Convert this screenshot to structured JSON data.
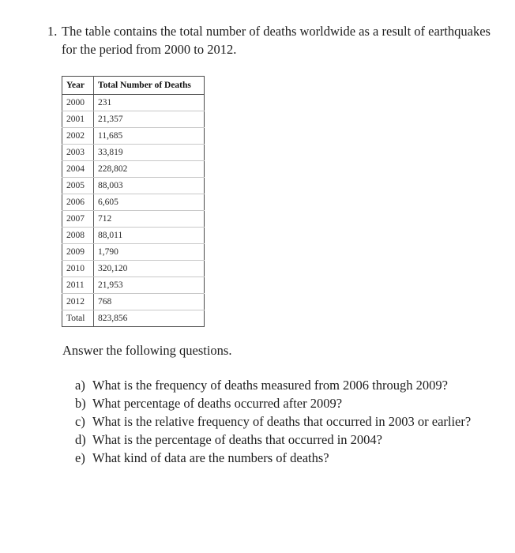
{
  "problem": {
    "number": "1.",
    "text": "The table contains the total number of deaths worldwide as a result of earthquakes for the period from 2000 to 2012."
  },
  "table": {
    "headers": [
      "Year",
      "Total Number of Deaths"
    ],
    "rows": [
      {
        "year": "2000",
        "deaths": "231"
      },
      {
        "year": "2001",
        "deaths": "21,357"
      },
      {
        "year": "2002",
        "deaths": "11,685"
      },
      {
        "year": "2003",
        "deaths": "33,819"
      },
      {
        "year": "2004",
        "deaths": "228,802"
      },
      {
        "year": "2005",
        "deaths": "88,003"
      },
      {
        "year": "2006",
        "deaths": "6,605"
      },
      {
        "year": "2007",
        "deaths": "712"
      },
      {
        "year": "2008",
        "deaths": "88,011"
      },
      {
        "year": "2009",
        "deaths": "1,790"
      },
      {
        "year": "2010",
        "deaths": "320,120"
      },
      {
        "year": "2011",
        "deaths": "21,953"
      },
      {
        "year": "2012",
        "deaths": "768"
      },
      {
        "year": "Total",
        "deaths": "823,856"
      }
    ]
  },
  "answer_prompt": "Answer the following questions.",
  "questions": [
    {
      "label": "a)",
      "text": "What is the frequency of deaths measured from 2006 through 2009?"
    },
    {
      "label": "b)",
      "text": "What percentage of deaths occurred after 2009?"
    },
    {
      "label": "c)",
      "text": "What is the relative frequency of deaths that occurred in 2003 or earlier?"
    },
    {
      "label": "d)",
      "text": "What is the percentage of deaths that occurred in 2004?"
    },
    {
      "label": "e)",
      "text": "What kind of data are the numbers of deaths?"
    }
  ],
  "colors": {
    "text": "#1d1d1d",
    "table_border": "#4a4a4a",
    "table_row_rule": "#c8c8c8",
    "page_background": "#ffffff"
  }
}
